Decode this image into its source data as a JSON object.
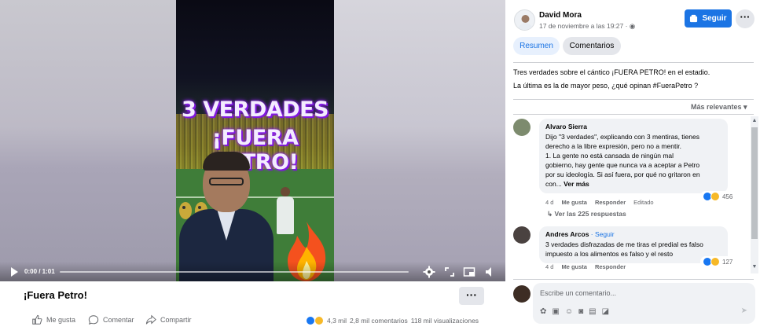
{
  "video": {
    "overlay_line1": "3 VERDADES",
    "overlay_line2": "¡FUERA PETRO!",
    "time": "0:00 / 1:01",
    "progress": 0
  },
  "post": {
    "title": "¡Fuera Petro!",
    "more_label": "···",
    "actions": {
      "like": "Me gusta",
      "comment": "Comentar",
      "share": "Compartir"
    },
    "reaction_count": "4,3 mil",
    "comment_count": "2,8 mil comentarios",
    "view_count": "118 mil visualizaciones"
  },
  "panel": {
    "author": "David Mora",
    "timestamp": "17 de noviembre a las 19:27 · ",
    "follow_label": "Seguir",
    "more_label": "···",
    "tabs": [
      "Resumen",
      "Comentarios"
    ],
    "text_line1": "Tres verdades sobre el cántico ¡FUERA PETRO! en el estadio.",
    "text_line2": "La última es la de mayor peso, ¿qué opinan #FueraPetro ?",
    "sort_label": "Más relevantes ▾",
    "comments": [
      {
        "name": "Alvaro Sierra",
        "follow": "",
        "lines": [
          "Dijo \"3 verdades\", explicando con 3 mentiras, tienes",
          "derecho a la libre expresión, pero no a mentir.",
          "1. La gente no está cansada de ningún mal",
          "gobierno, hay gente que nunca va a aceptar a Petro",
          "por su ideología. Si así fuera, por qué no gritaron en",
          "con..."
        ],
        "see_more": "Ver más",
        "age": "4 d",
        "like_label": "Me gusta",
        "reply_label": "Responder",
        "edited": "Editado",
        "reactions": "456",
        "replies": "Ver las 225 respuestas"
      },
      {
        "name": "Andres Arcos",
        "follow": " · Seguir",
        "lines": [
          "3 verdades disfrazadas de me tiras el predial es falso",
          "impuesto a los alimentos es falso y el resto"
        ],
        "age": "4 d",
        "like_label": "Me gusta",
        "reply_label": "Responder",
        "reactions": "127"
      }
    ],
    "composer_placeholder": "Escribe un comentario...",
    "composer_tools": [
      "emoji-icon",
      "avatar-sticker-icon",
      "smile-icon",
      "camera-icon",
      "gif-icon",
      "sticker-icon"
    ]
  },
  "colors": {
    "accent": "#1b74e4",
    "overlay_purple": "#8a23e8"
  }
}
